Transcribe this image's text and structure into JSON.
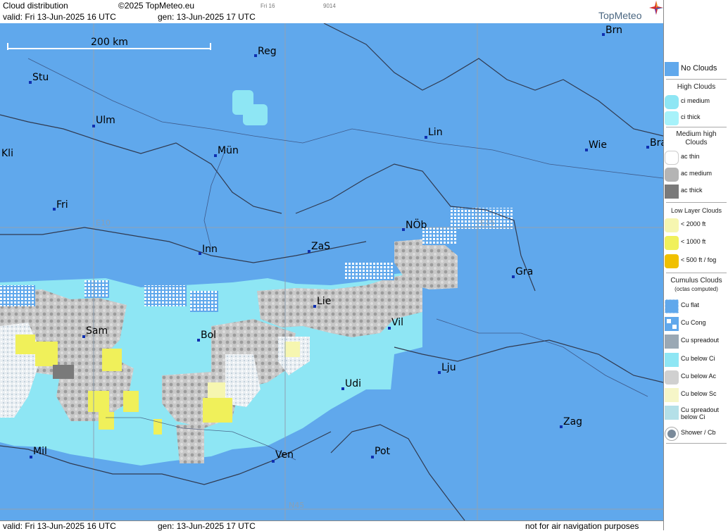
{
  "header": {
    "title": "Cloud distribution",
    "copyright": "©2025 TopMeteo.eu",
    "small_a": "Fri 16",
    "small_b": "9014",
    "valid": "valid:  Fri  13-Jun-2025  16 UTC",
    "gen": "gen: 13-Jun-2025 17 UTC",
    "brand": "TopMeteo"
  },
  "footer": {
    "valid": "valid:  Fri  13-Jun-2025  16 UTC",
    "gen": "gen: 13-Jun-2025 17 UTC",
    "notice": "not for air navigation purposes"
  },
  "map": {
    "scale_label": "200 km",
    "grid_labels": {
      "lon": "E10",
      "lon2": "E15",
      "lat": "N45"
    },
    "cities": [
      "Brn",
      "Reg",
      "Stu",
      "Ulm",
      "Lin",
      "Wie",
      "Bra",
      "Kli",
      "Mün",
      "Fri",
      "NÖb",
      "Inn",
      "ZaS",
      "Gra",
      "Lie",
      "Vil",
      "Sam",
      "Bol",
      "Lju",
      "Udi",
      "Zag",
      "Mil",
      "Ven",
      "Pot"
    ]
  },
  "legend": {
    "no_clouds": "No Clouds",
    "high": {
      "title": "High Clouds",
      "items": [
        "ci medium",
        "ci thick"
      ]
    },
    "medium": {
      "title_1": "Medium high",
      "title_2": "Clouds",
      "items": [
        "ac thin",
        "ac medium",
        "ac thick"
      ]
    },
    "low": {
      "title": "Low Layer Clouds",
      "items": [
        "< 2000 ft",
        "< 1000 ft",
        "< 500 ft / fog"
      ]
    },
    "cumulus": {
      "title": "Cumulus Clouds",
      "subtitle": "(octas computed)",
      "items": [
        "Cu flat",
        "Cu Cong",
        "Cu spreadout",
        "Cu below Ci",
        "Cu below Ac",
        "Cu below Sc",
        "Cu spreadout",
        "below Ci",
        "Shower / Cb"
      ]
    }
  },
  "colors": {
    "no_clouds": "#60a8ec",
    "ci_medium": "#8ee6f4",
    "ci_thick": "#a6f2fa",
    "ac_medium": "#b4b4b4",
    "ac_thick": "#7a7a7a",
    "low_2000": "#f6f6b0",
    "low_1000": "#f0f05a",
    "low_500": "#f0c000",
    "brand": "#4a6680"
  }
}
